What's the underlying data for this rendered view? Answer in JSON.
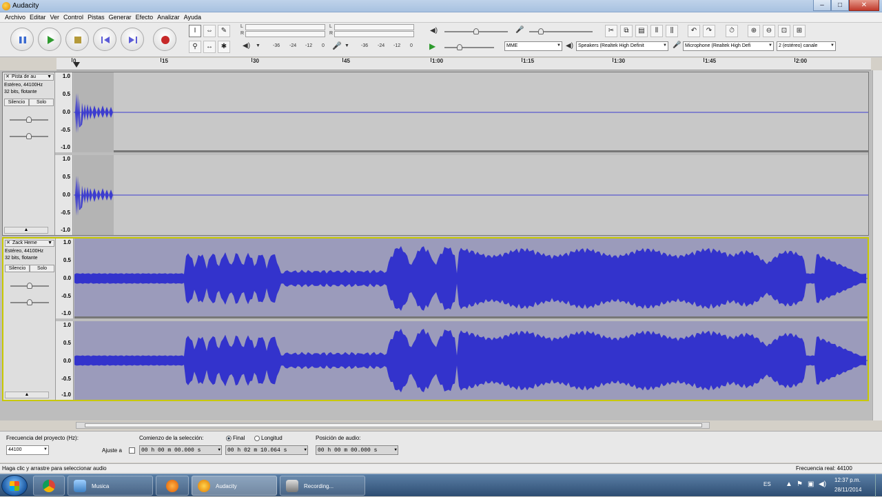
{
  "window": {
    "title": "Audacity"
  },
  "menu": [
    "Archivo",
    "Editar",
    "Ver",
    "Control",
    "Pistas",
    "Generar",
    "Efecto",
    "Analizar",
    "Ayuda"
  ],
  "transport": [
    "pause-icon",
    "play-icon",
    "stop-icon",
    "skip-start-icon",
    "skip-end-icon",
    "record-icon"
  ],
  "meters": {
    "scale": [
      "-36",
      "-24",
      "-12",
      "0"
    ],
    "lr": [
      "L",
      "R"
    ]
  },
  "devices": {
    "host": "MME",
    "output": "Speakers (Realtek High Definit",
    "input": "Microphone (Realtek High Defi",
    "channels": "2 (estéreo) canale"
  },
  "ruler": {
    "ticks": [
      "0",
      "15",
      "30",
      "45",
      "1:00",
      "1:15",
      "1:30",
      "1:45",
      "2:00"
    ]
  },
  "tracks": [
    {
      "name": "Pista de au",
      "format": [
        "Estéreo, 44100Hz",
        "32 bits, flotante"
      ],
      "mute": "Silencio",
      "solo": "Solo",
      "scale": [
        "1.0",
        "0.5",
        "0.0",
        "-0.5",
        "-1.0"
      ],
      "collapse": "▲"
    },
    {
      "name": "Zack Heme",
      "format": [
        "Estéreo, 44100Hz",
        "32 bits, flotante"
      ],
      "mute": "Silencio",
      "solo": "Solo",
      "scale": [
        "1.0",
        "0.5",
        "0.0",
        "-0.5",
        "-1.0"
      ],
      "collapse": "▲"
    }
  ],
  "selection": {
    "rate_label": "Frecuencia del proyecto (Hz):",
    "rate_value": "44100",
    "snap_label": "Ajuste a",
    "start_label": "Comienzo de la selección:",
    "end_label": "Final",
    "length_label": "Longitud",
    "start_value": "00 h 00 m 00.000 s",
    "end_value": "00 h 02 m 10.064 s",
    "pos_label": "Posición de audio:",
    "pos_value": "00 h 00 m 00.000 s"
  },
  "status": {
    "left": "Haga clic y arrastre para seleccionar audio",
    "right": "Frecuencia real: 44100"
  },
  "taskbar": {
    "items": [
      "Musica",
      "Audacity",
      "Recording..."
    ],
    "lang": "ES",
    "time": "12:37 p.m.",
    "date": "28/11/2014"
  }
}
